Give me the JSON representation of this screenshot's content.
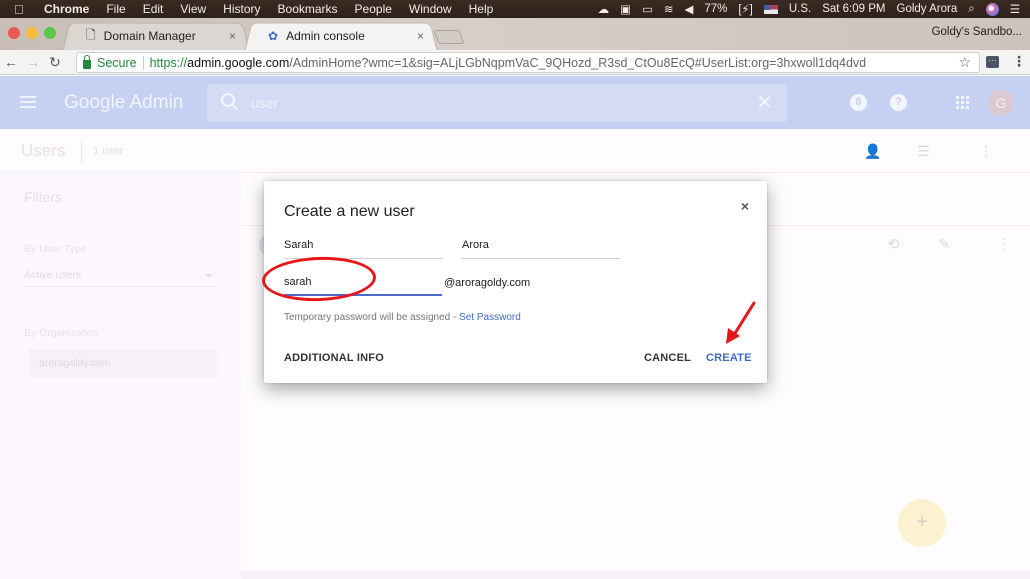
{
  "menubar": {
    "apple_icon": "apple-icon",
    "items": [
      "Chrome",
      "File",
      "Edit",
      "View",
      "History",
      "Bookmarks",
      "People",
      "Window",
      "Help"
    ],
    "status": {
      "battery": "77%",
      "input_source": "U.S.",
      "clock": "Sat 6:09 PM",
      "user": "Goldy Arora"
    }
  },
  "browser": {
    "tabs": [
      {
        "label": "Domain Manager",
        "icon": "page-icon",
        "active": false
      },
      {
        "label": "Admin console",
        "icon": "admin-icon",
        "active": true
      }
    ],
    "close_glyph": "×",
    "profile_name": "Goldy's Sandbo...",
    "address": {
      "secure_label": "Secure",
      "scheme": "https://",
      "host": "admin.google.com",
      "path": "/AdminHome?wmc=1&sig=ALjLGbNqpmVaC_9QHozd_R3sd_CtOu8EcQ#UserList:org=3hxwoll1dq4dvd"
    }
  },
  "app": {
    "title": "Google Admin",
    "search": {
      "value": "user",
      "placeholder": "Search"
    },
    "avatar_initial": "G",
    "hourglass_glyph": "8",
    "help_glyph": "?"
  },
  "subheader": {
    "title": "Users",
    "count": "1 user"
  },
  "sidebar": {
    "title": "Filters",
    "user_type_label": "By User Type",
    "user_type_value": "Active users",
    "org_label": "By Organization",
    "org_value": "aroragoldy.com"
  },
  "fab": {
    "glyph": "+"
  },
  "dialog": {
    "title": "Create a new user",
    "close_glyph": "×",
    "first_name": "Sarah",
    "last_name": "Arora",
    "username": "sarah",
    "domain": "@aroragoldy.com",
    "hint_text": "Temporary password will be assigned - ",
    "hint_link": "Set Password",
    "additional_info": "ADDITIONAL INFO",
    "cancel": "CANCEL",
    "create": "CREATE"
  },
  "annotations": {
    "highlight_color": "#e8161a"
  },
  "colors": {
    "header": "#c6d0f2",
    "accent": "#3e6ac4",
    "fab": "#fdf2cf"
  }
}
